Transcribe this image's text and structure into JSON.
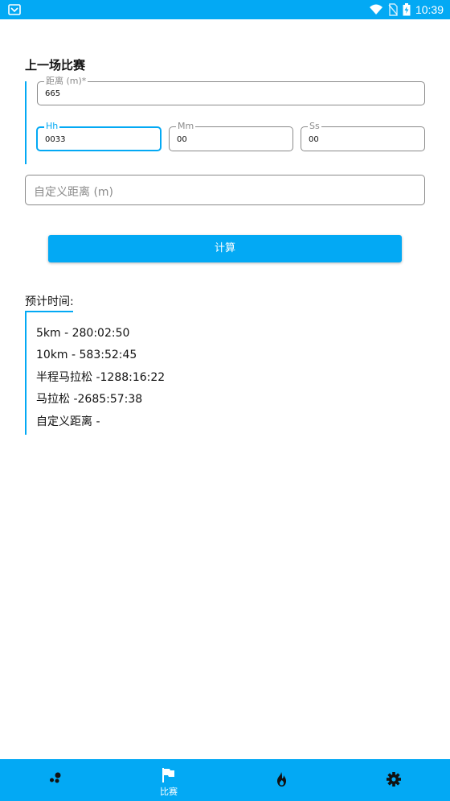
{
  "status_bar": {
    "time": "10:39",
    "icons": [
      "inbox-icon",
      "wifi-icon",
      "no-sim-icon",
      "battery-charging-icon"
    ]
  },
  "last_race": {
    "title": "上一场比赛",
    "distance": {
      "label": "距离 (m)*",
      "value": "665"
    },
    "hours": {
      "label": "Hh",
      "value": "0033"
    },
    "minutes": {
      "label": "Mm",
      "value": "00"
    },
    "seconds": {
      "label": "Ss",
      "value": "00"
    }
  },
  "custom_distance": {
    "placeholder": "自定义距离 (m)"
  },
  "calculate_button": {
    "label": "计算"
  },
  "predictions": {
    "title": "预计时间:",
    "items": [
      "5km - 280:02:50",
      "10km - 583:52:45",
      "半程马拉松 -1288:16:22",
      "马拉松 -2685:57:38",
      "自定义距离 -"
    ]
  },
  "bottom_nav": {
    "items": [
      {
        "icon": "dots-icon",
        "label": ""
      },
      {
        "icon": "flag-icon",
        "label": "比赛",
        "active": true
      },
      {
        "icon": "flame-icon",
        "label": ""
      },
      {
        "icon": "gear-icon",
        "label": ""
      }
    ]
  },
  "colors": {
    "accent": "#03a9f4",
    "border": "#8a8a8a"
  }
}
